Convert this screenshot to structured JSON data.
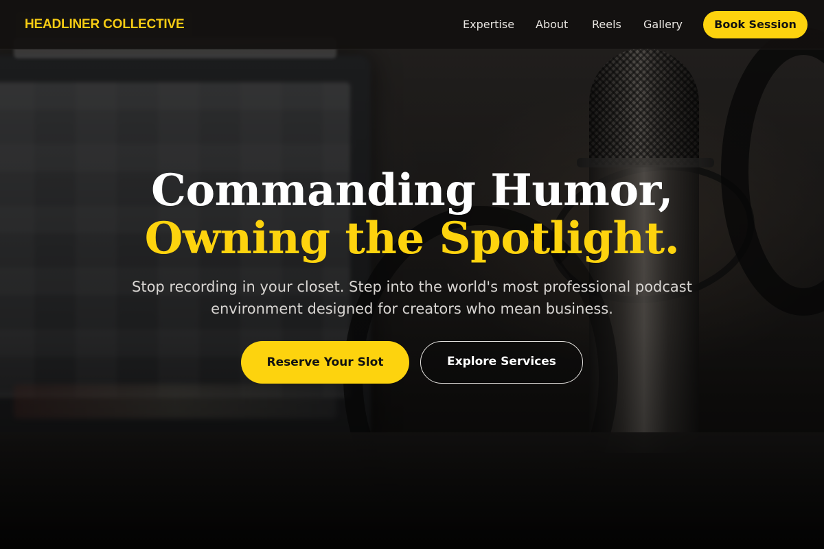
{
  "brand": {
    "name": "HEADLINER COLLECTIVE"
  },
  "nav": {
    "links": [
      "Expertise",
      "About",
      "Reels",
      "Gallery"
    ],
    "cta_label": "Book Session"
  },
  "hero": {
    "title_line1": "Commanding Humor,",
    "title_line2": "Owning the Spotlight.",
    "subtitle": "Stop recording in your closet. Step into the world's most professional podcast environment designed for creators who mean business.",
    "primary_button": "Reserve Your Slot",
    "secondary_button": "Explore Services"
  },
  "colors": {
    "accent": "#fdd30e",
    "nav_bg": "#12100f",
    "text_light": "#ffffff"
  }
}
